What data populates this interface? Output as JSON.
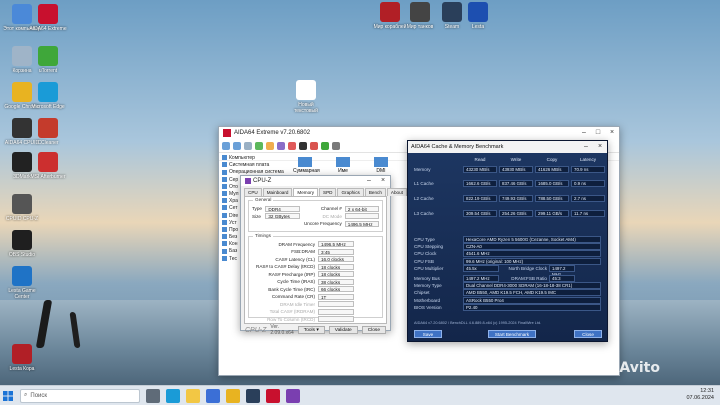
{
  "desktop_icons": [
    {
      "label": "Этот компьютер",
      "color": "#4b89d8"
    },
    {
      "label": "AIDA64 Extreme",
      "color": "#c8102e"
    },
    {
      "label": "Корзина",
      "color": "#9fb4c8"
    },
    {
      "label": "uTorrent",
      "color": "#3fa73a"
    },
    {
      "label": "Google Chrome",
      "color": "#e8b321"
    },
    {
      "label": "Microsoft Edge",
      "color": "#1a9bd7"
    },
    {
      "label": "AIDA64 CPUID",
      "color": "#333333"
    },
    {
      "label": "CCleaner",
      "color": "#c43b2c"
    },
    {
      "label": "3DMark",
      "color": "#222222"
    },
    {
      "label": "MSI Afterburner",
      "color": "#cc2f2f"
    },
    {
      "label": "CPUID CPU-Z",
      "color": "#555555"
    },
    {
      "label": "OBS Studio",
      "color": "#1f1f1f"
    },
    {
      "label": "Lesta Game Center",
      "color": "#1f73c6"
    },
    {
      "label": "Lesta Кора",
      "color": "#b11f26"
    },
    {
      "label": "Новый текстовый",
      "color": "#ffffff"
    },
    {
      "label": "Мир кораблей",
      "color": "#b11f26"
    },
    {
      "label": "Мир танков",
      "color": "#444444"
    },
    {
      "label": "Steam",
      "color": "#2a3f5a"
    },
    {
      "label": "Lesta",
      "color": "#1d4fb0"
    }
  ],
  "aida_main": {
    "title": "AIDA64 Extreme v7.20.6802",
    "tree": [
      "Компьютер",
      "Системная плата",
      "Операционная система",
      "Сер",
      "Ото",
      "Мул",
      "Хра",
      "Сет",
      "Dire",
      "Уст",
      "Про",
      "Без",
      "Кон",
      "Баз",
      "Тес"
    ],
    "content_items": [
      "Суммарная",
      "Име",
      "DMI",
      "IPMI"
    ]
  },
  "cpuz": {
    "title": "CPU-Z",
    "tabs": [
      "CPU",
      "Mainboard",
      "Memory",
      "SPD",
      "Graphics",
      "Bench",
      "About"
    ],
    "active_tab": "Memory",
    "general_label": "General",
    "type_label": "Type",
    "type_value": "DDR4",
    "size_label": "Size",
    "size_value": "32 GBytes",
    "channel_label": "Channel #",
    "channel_value": "2 x 64-bit",
    "dcmode_label": "DC Mode",
    "dcmode_value": "",
    "uncore_label": "Uncore Frequency",
    "uncore_value": "1496.5 MHz",
    "timings_label": "Timings",
    "timings": [
      {
        "label": "DRAM Frequency",
        "value": "1496.5 MHz",
        "dim": false
      },
      {
        "label": "FSB:DRAM",
        "value": "3:45",
        "dim": false
      },
      {
        "label": "CAS# Latency (CL)",
        "value": "16.0 clocks",
        "dim": false
      },
      {
        "label": "RAS# to CAS# Delay (tRCD)",
        "value": "18 clocks",
        "dim": false
      },
      {
        "label": "RAS# Precharge (tRP)",
        "value": "18 clocks",
        "dim": false
      },
      {
        "label": "Cycle Time (tRAS)",
        "value": "38 clocks",
        "dim": false
      },
      {
        "label": "Bank Cycle Time (tRC)",
        "value": "66 clocks",
        "dim": false
      },
      {
        "label": "Command Rate (CR)",
        "value": "1T",
        "dim": false
      },
      {
        "label": "DRAM Idle Timer",
        "value": "",
        "dim": true
      },
      {
        "label": "Total CAS# (tRDRAM)",
        "value": "",
        "dim": true
      },
      {
        "label": "Row To Column (tRCD)",
        "value": "",
        "dim": true
      }
    ],
    "brand": "CPU-Z",
    "version": "Ver. 2.09.0.x64",
    "tools_btn": "Tools",
    "validate_btn": "Validate",
    "close_btn": "Close"
  },
  "bench": {
    "title": "AIDA64 Cache & Memory Benchmark",
    "headers": [
      "Read",
      "Write",
      "Copy",
      "Latency"
    ],
    "rows": [
      {
        "label": "Memory",
        "values": [
          "43230 MB/s",
          "43930 MB/s",
          "41626 MB/s",
          "70.9 ns"
        ]
      },
      {
        "label": "L1 Cache",
        "values": [
          "1662.6 GB/s",
          "837.46 GB/s",
          "1685.0 GB/s",
          "0.9 ns"
        ]
      },
      {
        "label": "L2 Cache",
        "values": [
          "822.19 GB/s",
          "749.93 GB/s",
          "788.50 GB/s",
          "2.7 ns"
        ]
      },
      {
        "label": "L3 Cache",
        "values": [
          "309.54 GB/s",
          "254.26 GB/s",
          "299.11 GB/s",
          "11.7 ns"
        ]
      }
    ],
    "cpu_type_label": "CPU Type",
    "cpu_type": "HexaCore AMD Ryzen 5 5600G  (Cezanne, Socket AM4)",
    "stepping_label": "CPU Stepping",
    "stepping": "CZN-A0",
    "clock_label": "CPU Clock",
    "clock": "4541.6 MHz",
    "fsb_label": "CPU FSB",
    "fsb": "99.6 MHz  (original: 100 MHz)",
    "mult_label": "CPU Multiplier",
    "mult": "45.5x",
    "nb_label": "North Bridge Clock",
    "nb": "1497.2 MHz",
    "membus_label": "Memory Bus",
    "membus": "1497.2 MHz",
    "ratio_label": "DRAM:FSB Ratio",
    "ratio": "45:3",
    "memtype_label": "Memory Type",
    "memtype": "Dual Channel DDR4-3000 SDRAM  (16-18-18-38 CR1)",
    "chipset_label": "Chipset",
    "chipset": "AMD B550, AMD K19.5 FCH, AMD K19.5 IMC",
    "mobo_label": "Motherboard",
    "mobo": "ASRock B550 Pro4",
    "bios_label": "BIOS Version",
    "bios": "P2.40",
    "footer": "AIDA64 v7.20.6802 / BenchDLL 4.6.889.8-x64  (c) 1995-2024 FinalWire Ltd.",
    "save_btn": "Save",
    "start_btn": "Start Benchmark",
    "close_btn": "Close"
  },
  "taskbar": {
    "search_placeholder": "Поиск",
    "time": "12:31",
    "date": "07.06.2024"
  },
  "watermark": "Avito"
}
